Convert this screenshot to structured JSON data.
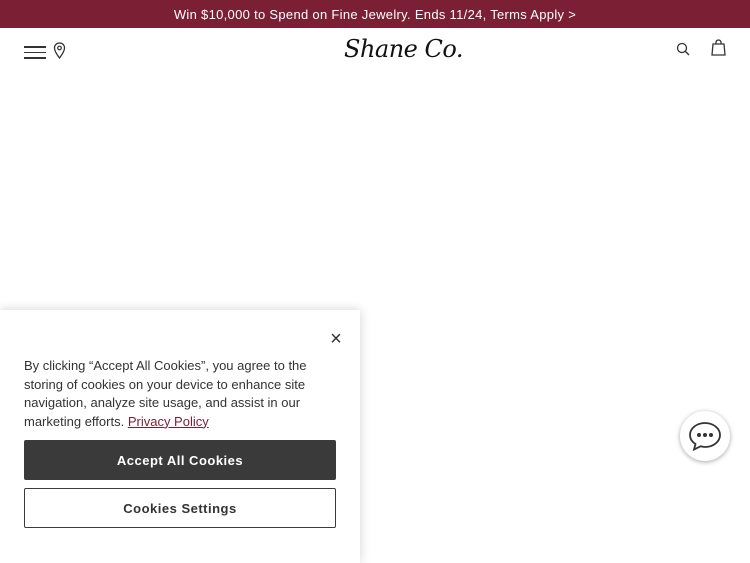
{
  "promo": {
    "text": "Win $10,000 to Spend on Fine Jewelry. Ends 11/24, Terms Apply >"
  },
  "header": {
    "logo_text": "Shane Co.",
    "icons": [
      "menu-icon",
      "store-locator-icon",
      "search-icon",
      "shopping-bag-icon"
    ]
  },
  "cookie_banner": {
    "close_label": "×",
    "text": "By clicking “Accept All Cookies”, you agree to the storing of cookies on your device to enhance site navigation, analyze site usage, and assist in our marketing efforts.",
    "policy_link": "Privacy Policy",
    "accept_label": "Accept All Cookies",
    "settings_label": "Cookies Settings"
  },
  "chat": {
    "icon": "chat-icon"
  },
  "colors": {
    "brand": "#7a1f34",
    "button_dark": "#3a3a3a"
  }
}
